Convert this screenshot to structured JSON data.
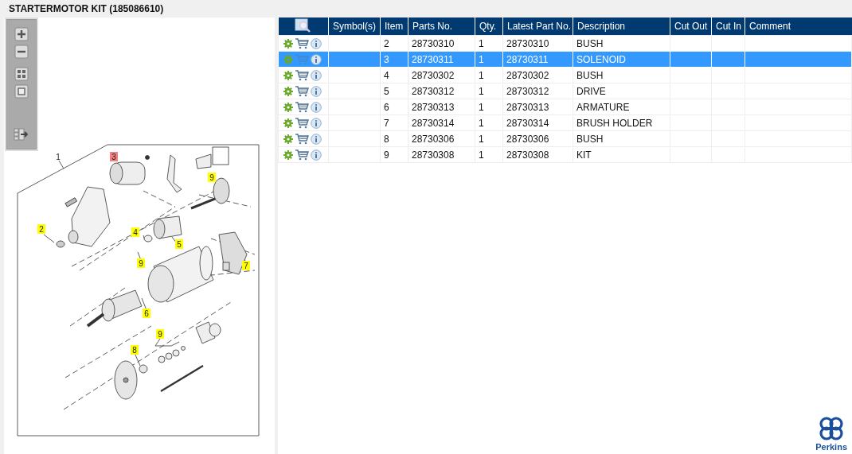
{
  "title": "STARTERMOTOR KIT (185086610)",
  "callouts": [
    {
      "label": "1",
      "kind": "plain",
      "selected": false
    },
    {
      "label": "3",
      "kind": "tag",
      "selected": true
    },
    {
      "label": "9",
      "kind": "tag",
      "selected": false
    },
    {
      "label": "2",
      "kind": "tag",
      "selected": false
    },
    {
      "label": "4",
      "kind": "tag",
      "selected": false
    },
    {
      "label": "5",
      "kind": "tag",
      "selected": false
    },
    {
      "label": "9",
      "kind": "tag",
      "selected": false
    },
    {
      "label": "7",
      "kind": "tag",
      "selected": false
    },
    {
      "label": "6",
      "kind": "tag",
      "selected": false
    },
    {
      "label": "9",
      "kind": "tag",
      "selected": false
    },
    {
      "label": "8",
      "kind": "tag",
      "selected": false
    }
  ],
  "table": {
    "columns": [
      "Symbol(s)",
      "Item",
      "Parts No.",
      "Qty.",
      "Latest Part No.",
      "Description",
      "Cut Out",
      "Cut In",
      "Comment"
    ],
    "rows": [
      {
        "selected": false,
        "item": "2",
        "parts_no": "28730310",
        "qty": "1",
        "latest_part_no": "28730310",
        "description": "BUSH"
      },
      {
        "selected": true,
        "item": "3",
        "parts_no": "28730311",
        "qty": "1",
        "latest_part_no": "28730311",
        "description": "SOLENOID"
      },
      {
        "selected": false,
        "item": "4",
        "parts_no": "28730302",
        "qty": "1",
        "latest_part_no": "28730302",
        "description": "BUSH"
      },
      {
        "selected": false,
        "item": "5",
        "parts_no": "28730312",
        "qty": "1",
        "latest_part_no": "28730312",
        "description": "DRIVE"
      },
      {
        "selected": false,
        "item": "6",
        "parts_no": "28730313",
        "qty": "1",
        "latest_part_no": "28730313",
        "description": "ARMATURE"
      },
      {
        "selected": false,
        "item": "7",
        "parts_no": "28730314",
        "qty": "1",
        "latest_part_no": "28730314",
        "description": "BRUSH HOLDER"
      },
      {
        "selected": false,
        "item": "8",
        "parts_no": "28730306",
        "qty": "1",
        "latest_part_no": "28730306",
        "description": "BUSH"
      },
      {
        "selected": false,
        "item": "9",
        "parts_no": "28730308",
        "qty": "1",
        "latest_part_no": "28730308",
        "description": "KIT"
      }
    ]
  },
  "logo": {
    "text": "Perkins"
  }
}
